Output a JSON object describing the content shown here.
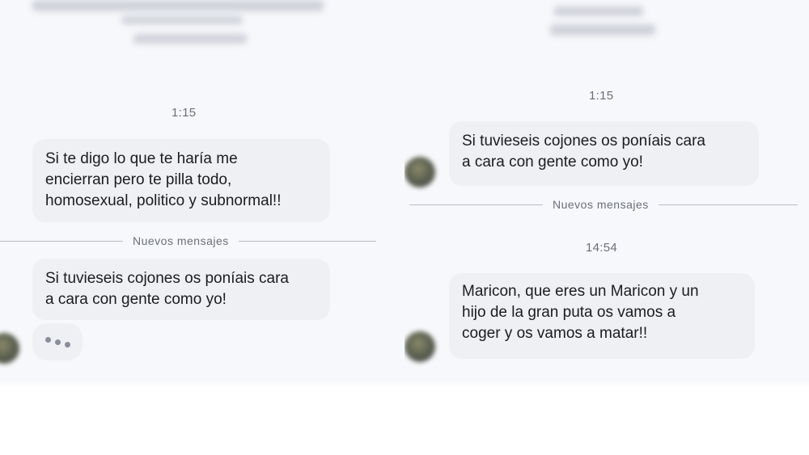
{
  "left_panel": {
    "timestamp": "1:15",
    "messages": [
      "Si te digo lo que te haría me\nencierran pero te pilla todo,\nhomosexual, politico y subnormal!!",
      "Si tuvieseis cojones os poníais cara\na cara con gente como yo!"
    ],
    "divider_label": "Nuevos mensajes",
    "typing_indicator": "typing-dots-icon"
  },
  "right_panel": {
    "timestamp_1": "1:15",
    "messages": [
      "Si tuvieseis cojones os poníais cara\na cara con gente como yo!",
      "Maricon, que eres un Maricon y un\nhijo de la gran puta os vamos a\ncoger y os vamos a matar!!"
    ],
    "divider_label": "Nuevos mensajes",
    "timestamp_2": "14:54"
  },
  "colors": {
    "bubble": "#eef0f4",
    "background": "#f7f8fb",
    "text": "#1b1c1f",
    "meta": "#6b6f78"
  }
}
